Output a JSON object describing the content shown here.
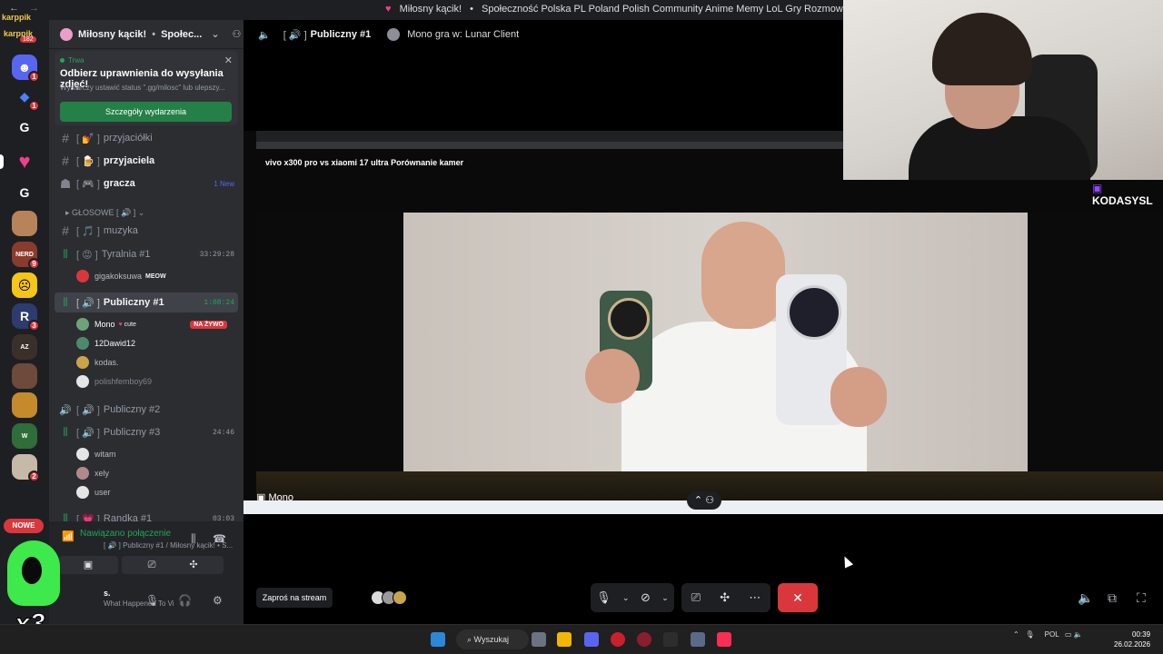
{
  "window": {
    "title_server": "Miłosny kącik!",
    "title_desc": "Społeczność Polska PL Poland Polish Community Anime Memy LoL Gry Rozmowy RP"
  },
  "overlay": {
    "name_top": "karppik",
    "name_bottom": "karppik",
    "multiplier": "x3"
  },
  "rail": {
    "badge_count": "182",
    "new_label": "NOWE",
    "badges": [
      "1",
      "1",
      "4",
      "9",
      "3",
      "2"
    ]
  },
  "server": {
    "name": "Miłosny kącik!",
    "name_rest": "Społec..."
  },
  "event": {
    "status": "Trwa",
    "title": "Odbierz uprawnienia do wysyłania zdjęć!",
    "subtitle": "Wystarczy ustawić status \".gg/milosc\" lub ulepszy...",
    "button": "Szczegóły wydarzenia"
  },
  "channels": {
    "przyjaciolki": "przyjaciółki",
    "przyjaciela": "przyjaciela",
    "gracza": "gracza",
    "gracza_new": "1 New",
    "category": "GŁOSOWE",
    "muzyka": "muzyka",
    "tyralnia": "Tyralnia #1",
    "tyralnia_time": "33:29:28",
    "tyralnia_user": "gigakoksuwa",
    "tyralnia_user_tag": "MEOW",
    "publiczny1": "Publiczny #1",
    "publiczny1_time": "1:08:24",
    "p1_users": [
      "Mono",
      "12Dawid12",
      "kodas.",
      "polishfemboy69"
    ],
    "mono_tag": "cute",
    "live": "NA ŻYWO",
    "publiczny2": "Publiczny #2",
    "publiczny3": "Publiczny #3",
    "publiczny3_time": "24:46",
    "p3_users": [
      "witam",
      "xely",
      "user"
    ],
    "randka": "Randka #1",
    "randka_time": "03:03"
  },
  "voice": {
    "connected": "Nawiązano połączenie",
    "path": "Publiczny #1 / Miłosny kącik!",
    "username": "s.",
    "status": "What Happened To Vi"
  },
  "header": {
    "channel": "Publiczny #1",
    "activity": "Mono gra w: Lunar Client"
  },
  "stream": {
    "video_title": "vivo x300 pro vs xiaomi  17 ultra  Porównanie kamer",
    "streamer": "Mono",
    "watermark": "KODASYSL"
  },
  "controls": {
    "invite": "Zaproś na stream"
  },
  "taskbar": {
    "search": "Wyszukaj",
    "lang": "POL",
    "time": "00:39",
    "date": "26.02.2026"
  },
  "colors": {
    "green": "#23a55a",
    "red": "#da373c",
    "blurple": "#5865f2",
    "bg": "#2b2d31"
  }
}
